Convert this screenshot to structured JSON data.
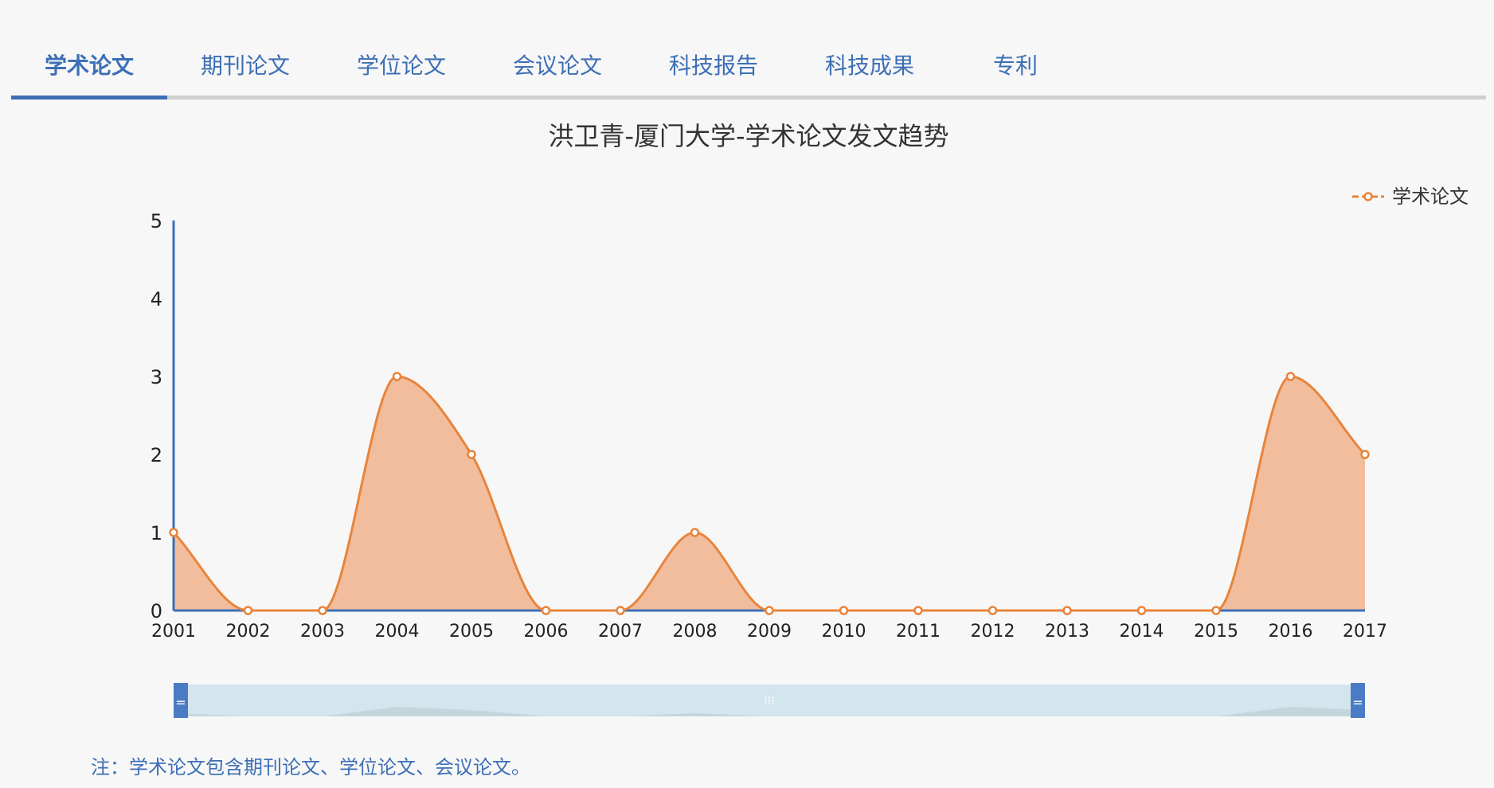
{
  "tabs": [
    {
      "label": "学术论文",
      "active": true
    },
    {
      "label": "期刊论文",
      "active": false
    },
    {
      "label": "学位论文",
      "active": false
    },
    {
      "label": "会议论文",
      "active": false
    },
    {
      "label": "科技报告",
      "active": false
    },
    {
      "label": "科技成果",
      "active": false
    },
    {
      "label": "专利",
      "active": false
    }
  ],
  "note": "注：学术论文包含期刊论文、学位论文、会议论文。",
  "colors": {
    "accent": "#3d6fb6",
    "series": "#e8843c",
    "area": "#f2bd9c",
    "slider": "#d3e5ed",
    "handle": "#4a7bc4"
  },
  "chart_data": {
    "type": "area",
    "title": "洪卫青-厦门大学-学术论文发文趋势",
    "xlabel": "",
    "ylabel": "",
    "categories": [
      "2001",
      "2002",
      "2003",
      "2004",
      "2005",
      "2006",
      "2007",
      "2008",
      "2009",
      "2010",
      "2011",
      "2012",
      "2013",
      "2014",
      "2015",
      "2016",
      "2017"
    ],
    "series": [
      {
        "name": "学术论文",
        "values": [
          1,
          0,
          0,
          3,
          2,
          0,
          0,
          1,
          0,
          0,
          0,
          0,
          0,
          0,
          0,
          3,
          2
        ]
      }
    ],
    "ylim": [
      0,
      5
    ],
    "yticks": [
      0,
      1,
      2,
      3,
      4,
      5
    ],
    "smooth": true,
    "grid": false,
    "legend": "top-right",
    "datazoom": true
  }
}
